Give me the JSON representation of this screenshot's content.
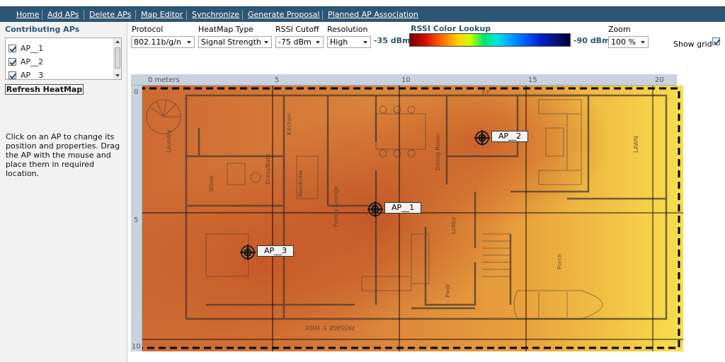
{
  "nav": {
    "items": [
      {
        "label": "Home"
      },
      {
        "label": "Add APs"
      },
      {
        "label": "Delete APs"
      },
      {
        "label": "Map Editor"
      },
      {
        "label": "Synchronize"
      },
      {
        "label": "Generate Proposal"
      },
      {
        "label": "Planned AP Association"
      }
    ]
  },
  "left": {
    "title": "Contributing APs",
    "aps": [
      {
        "label": "AP__1",
        "checked": true
      },
      {
        "label": "AP__2",
        "checked": true
      },
      {
        "label": "AP__3",
        "checked": true
      }
    ],
    "refresh_label": "Refresh HeatMap",
    "help": "Click on an AP to change its position and properties. Drag the AP with the mouse and place them in required location."
  },
  "toolbar": {
    "protocol": {
      "label": "Protocol",
      "value": "802.11b/g/n"
    },
    "heatmap_type": {
      "label": "HeatMap Type",
      "value": "Signal Strength"
    },
    "rssi_cutoff": {
      "label": "RSSI Cutoff",
      "value": "-75 dBm"
    },
    "resolution": {
      "label": "Resolution",
      "value": "High"
    },
    "rssi_lookup": {
      "title": "RSSI Color Lookup",
      "min_label": "-35 dBm",
      "max_label": "-90 dBm"
    },
    "zoom": {
      "label": "Zoom",
      "value": "100 %"
    },
    "show_grid": {
      "label": "Show grid",
      "checked": true
    }
  },
  "map": {
    "ruler_x": [
      "0 meters",
      "5",
      "10",
      "15",
      "20"
    ],
    "ruler_y": [
      "0",
      "5",
      "10"
    ],
    "access_points": [
      {
        "label": "AP__1"
      },
      {
        "label": "AP__2"
      },
      {
        "label": "AP__3"
      }
    ],
    "room_labels": [
      "Laundry",
      "Kitchen",
      "Dress/Bath",
      "Wardrobe",
      "Stove",
      "Family Lounge",
      "Dining Room",
      "Lobby",
      "Pwdr",
      "Porch",
      "LAWN",
      "PASSAGE 5' WIDE",
      "F.P"
    ]
  }
}
